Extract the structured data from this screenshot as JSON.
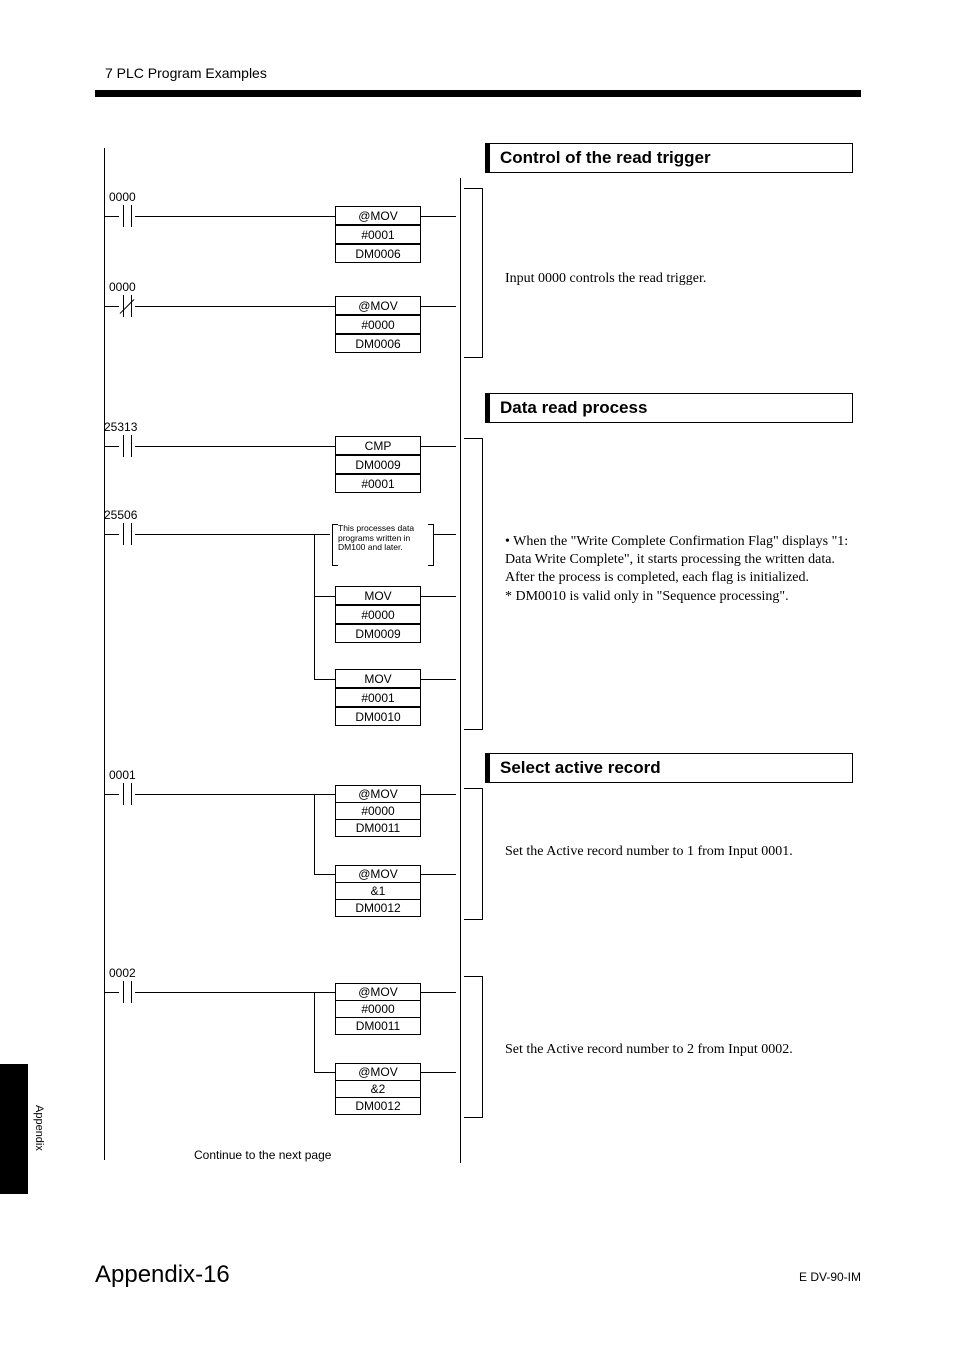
{
  "header": "7  PLC Program Examples",
  "sidebar_label": "Appendix",
  "page_number": "Appendix-16",
  "doc_id": "E DV-90-IM",
  "continue_text": "Continue to the next page",
  "sections": {
    "s1": {
      "title": "Control of the read trigger",
      "body": "Input 0000 controls the read trigger."
    },
    "s2": {
      "title": "Data read process",
      "body_lines": [
        "• When the \"Write Complete Confirmation Flag\" displays \"1: Data Write Complete\", it starts processing the written data. After the process is completed, each flag is initialized.",
        "* DM0010 is valid only in \"Sequence processing\"."
      ]
    },
    "s3": {
      "title": "Select active record",
      "body1": "Set the Active record number to 1 from Input 0001.",
      "body2": "Set the Active record number to 2 from Input 0002."
    }
  },
  "ladder": {
    "rungs": {
      "r1": {
        "label": "0000",
        "boxes": [
          "@MOV",
          "#0001",
          "DM0006"
        ]
      },
      "r2": {
        "label": "0000",
        "boxes": [
          "@MOV",
          "#0000",
          "DM0006"
        ]
      },
      "r3": {
        "label": "25313",
        "boxes": [
          "CMP",
          "DM0009",
          "#0001"
        ]
      },
      "r4": {
        "label": "25506",
        "note": "This processes data programs written in DM100 and later.",
        "boxesA": [
          "MOV",
          "#0000",
          "DM0009"
        ],
        "boxesB": [
          "MOV",
          "#0001",
          "DM0010"
        ]
      },
      "r5": {
        "label": "0001",
        "boxesA": [
          "@MOV",
          "#0000",
          "DM0011"
        ],
        "boxesB": [
          "@MOV",
          "&1",
          "DM0012"
        ]
      },
      "r6": {
        "label": "0002",
        "boxesA": [
          "@MOV",
          "#0000",
          "DM0011"
        ],
        "boxesB": [
          "@MOV",
          "&2",
          "DM0012"
        ]
      }
    }
  }
}
